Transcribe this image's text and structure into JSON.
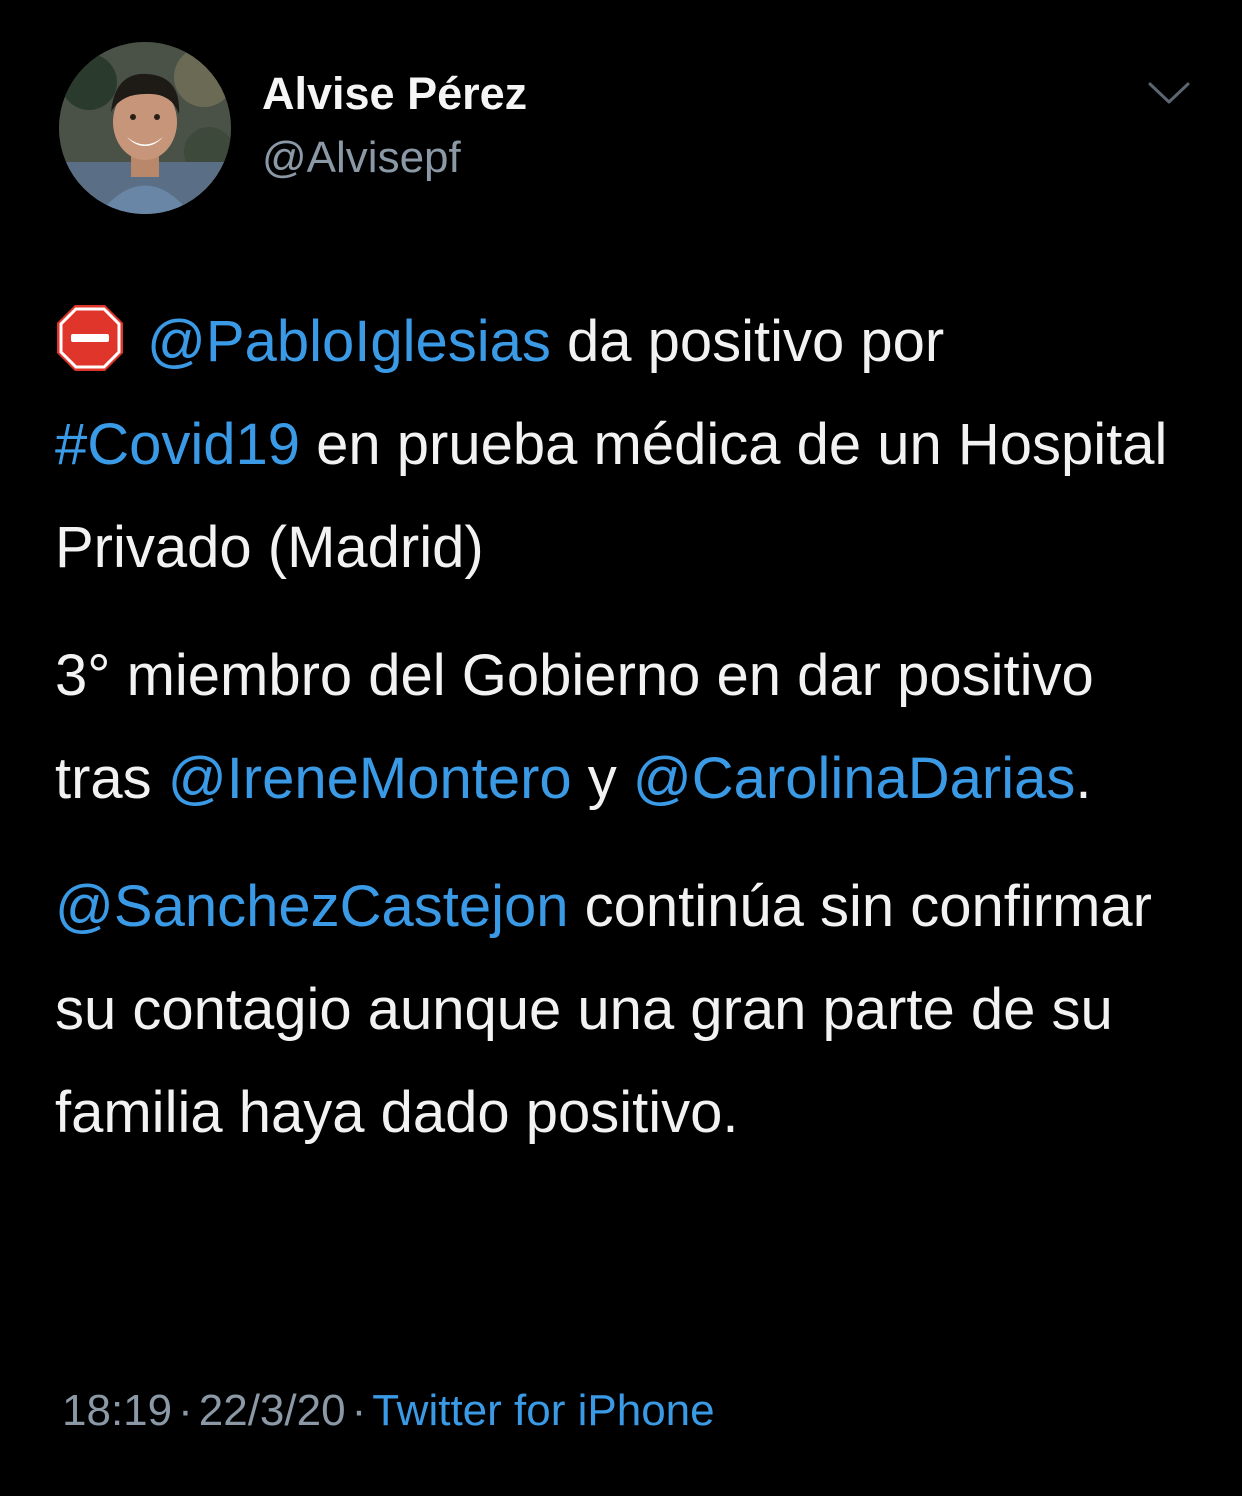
{
  "author": {
    "name": "Alvise Pérez",
    "handle": "@Alvisepf",
    "avatar_icon": "profile-photo"
  },
  "menu": {
    "icon": "chevron-down-icon"
  },
  "tweet": {
    "p1": {
      "icon": "stop-sign-icon",
      "mention1": "@PabloIglesias",
      "text1": " da positivo por ",
      "hashtag": "#Covid19",
      "text2": " en prueba médica de un Hospital Privado (Madrid)"
    },
    "p2": {
      "text1": "3° miembro del Gobierno en dar positivo tras ",
      "mention1": "@IreneMontero",
      "text2": " y ",
      "mention2": "@CarolinaDarias",
      "text3": "."
    },
    "p3": {
      "mention1": "@SanchezCastejon",
      "text1": " continúa sin confirmar su contagio aunque una gran parte de su familia haya dado positivo."
    }
  },
  "meta": {
    "time": "18:19",
    "date": "22/3/20",
    "separator": "·",
    "source": "Twitter for iPhone"
  },
  "colors": {
    "background": "#000000",
    "text": "#f2f2f2",
    "secondary": "#8b98a5",
    "link": "#3b9ae6",
    "stop_sign": "#e0352b"
  }
}
